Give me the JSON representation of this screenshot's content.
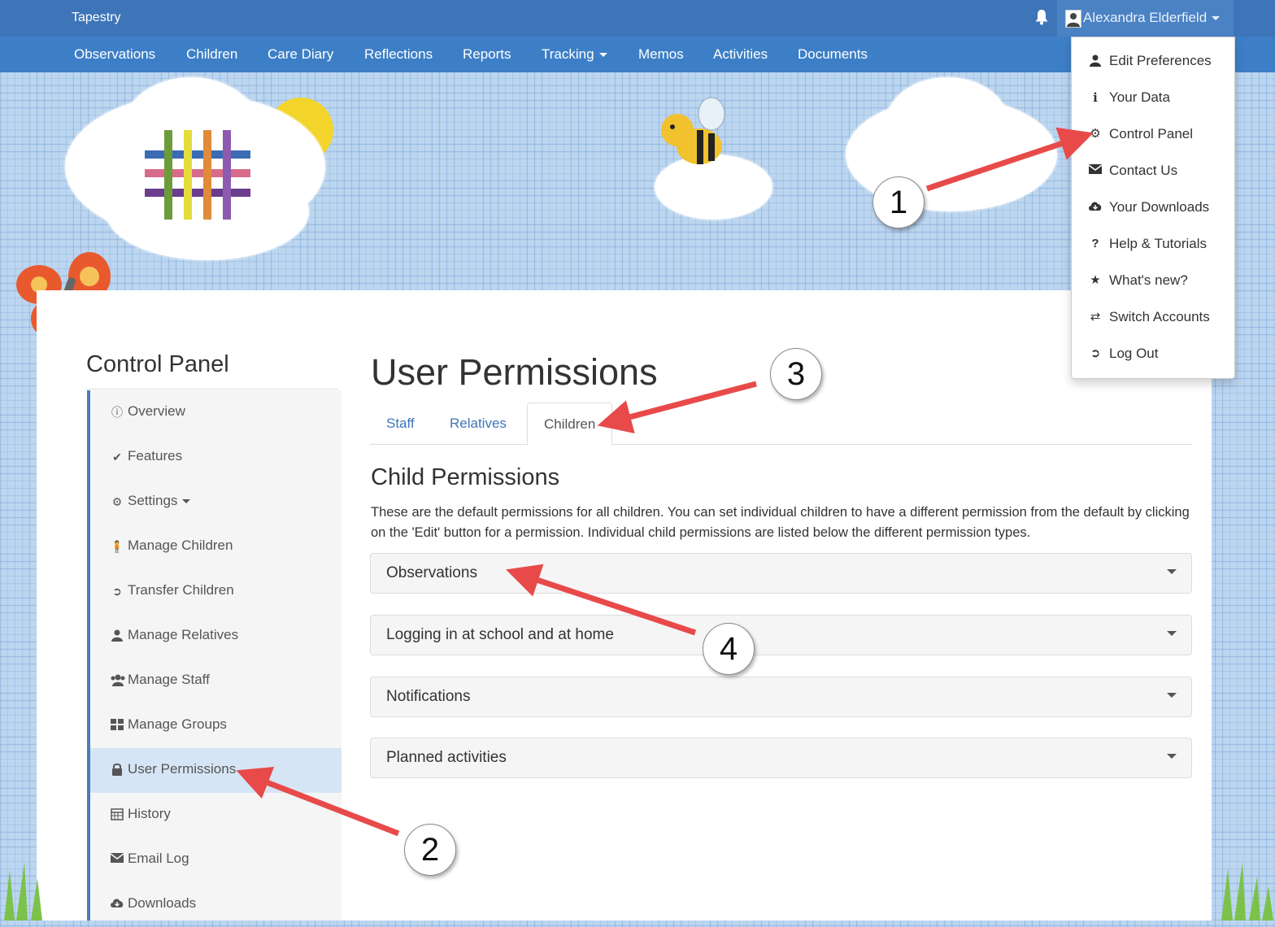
{
  "brand": "Tapestry",
  "user": {
    "name": "Alexandra Elderfield"
  },
  "nav": [
    "Observations",
    "Children",
    "Care Diary",
    "Reflections",
    "Reports",
    "Tracking",
    "Memos",
    "Activities",
    "Documents"
  ],
  "user_menu": [
    {
      "label": "Edit Preferences",
      "icon": "user-icon"
    },
    {
      "label": "Your Data",
      "icon": "info-icon"
    },
    {
      "label": "Control Panel",
      "icon": "gear-icon"
    },
    {
      "label": "Contact Us",
      "icon": "envelope-icon"
    },
    {
      "label": "Your Downloads",
      "icon": "cloud-download-icon"
    },
    {
      "label": "Help & Tutorials",
      "icon": "question-icon"
    },
    {
      "label": "What's new?",
      "icon": "star-icon"
    },
    {
      "label": "Switch Accounts",
      "icon": "transfer-icon"
    },
    {
      "label": "Log Out",
      "icon": "log-out-icon"
    }
  ],
  "sidebar": {
    "title": "Control Panel",
    "items": [
      {
        "label": "Overview",
        "icon": "info-circle-icon"
      },
      {
        "label": "Features",
        "icon": "check-icon"
      },
      {
        "label": "Settings",
        "icon": "gear-icon"
      },
      {
        "label": "Manage Children",
        "icon": "child-icon"
      },
      {
        "label": "Transfer Children",
        "icon": "circle-arrow-icon"
      },
      {
        "label": "Manage Relatives",
        "icon": "user-icon"
      },
      {
        "label": "Manage Staff",
        "icon": "users-icon"
      },
      {
        "label": "Manage Groups",
        "icon": "grid-icon"
      },
      {
        "label": "User Permissions",
        "icon": "lock-icon"
      },
      {
        "label": "History",
        "icon": "calendar-icon"
      },
      {
        "label": "Email Log",
        "icon": "envelope-icon"
      },
      {
        "label": "Downloads",
        "icon": "cloud-download-icon"
      }
    ],
    "active_index": 8
  },
  "main": {
    "title": "User Permissions",
    "tabs": [
      "Staff",
      "Relatives",
      "Children"
    ],
    "active_tab": "Children",
    "section_title": "Child Permissions",
    "description": "These are the default permissions for all children. You can set individual children to have a different permission from the default by clicking on the 'Edit' button for a permission. Individual child permissions are listed below the different permission types.",
    "accordions": [
      "Observations",
      "Logging in at school and at home",
      "Notifications",
      "Planned activities"
    ]
  },
  "callouts": [
    "1",
    "2",
    "3",
    "4"
  ],
  "colors": {
    "topbar": "#3d75b8",
    "navbar": "#3d7fc6",
    "arrow": "#e84a4a",
    "active_side": "#d6e5f5"
  }
}
